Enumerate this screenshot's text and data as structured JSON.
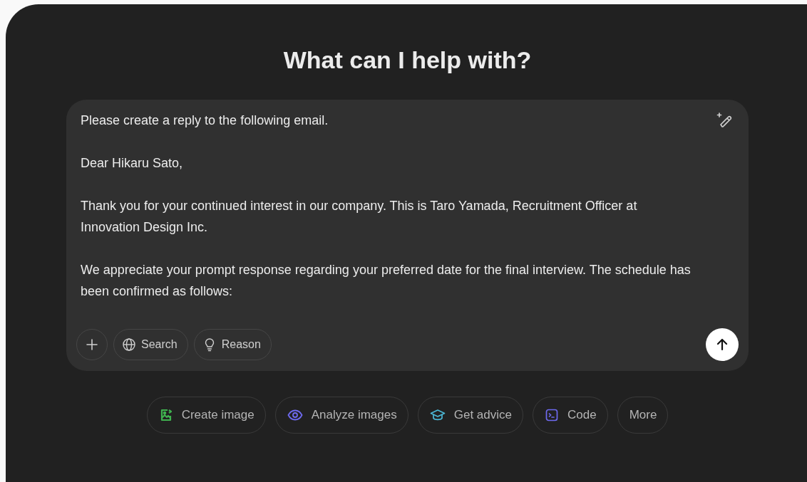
{
  "heading": "What can I help with?",
  "composer": {
    "paragraphs": [
      "Please create a reply to the following email.",
      "Dear Hikaru Sato,",
      "Thank you for your continued interest in our company. This is Taro Yamada, Recruitment Officer at Innovation Design Inc.",
      "We appreciate your prompt response regarding your preferred date for the final interview. The schedule has been confirmed as follows:"
    ],
    "tools": [
      {
        "kind": "add"
      },
      {
        "kind": "search",
        "label": "Search"
      },
      {
        "kind": "reason",
        "label": "Reason"
      }
    ]
  },
  "suggestions": [
    {
      "kind": "image",
      "label": "Create image",
      "color": "#3fb24f"
    },
    {
      "kind": "eye",
      "label": "Analyze images",
      "color": "#6e6af0"
    },
    {
      "kind": "cap",
      "label": "Get advice",
      "color": "#4cb8d6"
    },
    {
      "kind": "code",
      "label": "Code",
      "color": "#6e6af0"
    },
    {
      "kind": "none",
      "label": "More"
    }
  ]
}
